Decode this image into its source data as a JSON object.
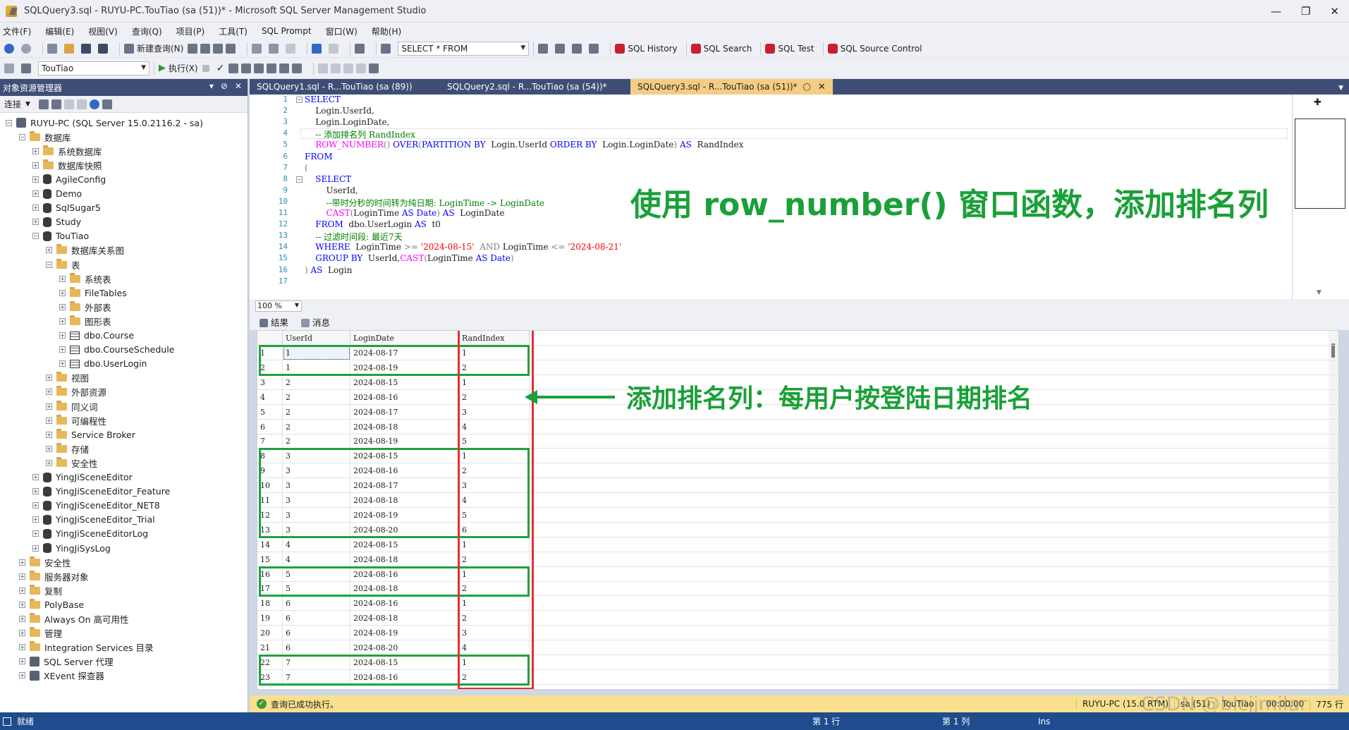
{
  "window": {
    "title": "SQLQuery3.sql - RUYU-PC.TouTiao (sa (51))* - Microsoft SQL Server Management Studio"
  },
  "menu": [
    "文件(F)",
    "编辑(E)",
    "视图(V)",
    "查询(Q)",
    "项目(P)",
    "工具(T)",
    "SQL Prompt",
    "窗口(W)",
    "帮助(H)"
  ],
  "toolbar1": {
    "new_query": "新建查询(N)",
    "combo_value": "SELECT * FROM",
    "sql_history": "SQL History",
    "sql_search": "SQL Search",
    "sql_test": "SQL Test",
    "sql_source_control": "SQL Source Control"
  },
  "toolbar2": {
    "database": "TouTiao",
    "execute": "执行(X)"
  },
  "object_explorer": {
    "title": "对象资源管理器",
    "connect": "连接",
    "items": [
      {
        "label": "RUYU-PC (SQL Server 15.0.2116.2 - sa)",
        "depth": 0,
        "icon": "server-icon",
        "expanded": true
      },
      {
        "label": "数据库",
        "depth": 1,
        "icon": "folder-icon",
        "expanded": true
      },
      {
        "label": "系统数据库",
        "depth": 2,
        "icon": "folder-icon",
        "expanded": false
      },
      {
        "label": "数据库快照",
        "depth": 2,
        "icon": "folder-icon",
        "expanded": false
      },
      {
        "label": "AgileConfig",
        "depth": 2,
        "icon": "database-icon",
        "expanded": false
      },
      {
        "label": "Demo",
        "depth": 2,
        "icon": "database-icon",
        "expanded": false
      },
      {
        "label": "SqlSugar5",
        "depth": 2,
        "icon": "database-icon",
        "expanded": false
      },
      {
        "label": "Study",
        "depth": 2,
        "icon": "database-icon",
        "expanded": false
      },
      {
        "label": "TouTiao",
        "depth": 2,
        "icon": "database-icon",
        "expanded": true
      },
      {
        "label": "数据库关系图",
        "depth": 3,
        "icon": "folder-icon",
        "expanded": false
      },
      {
        "label": "表",
        "depth": 3,
        "icon": "folder-icon",
        "expanded": true
      },
      {
        "label": "系统表",
        "depth": 4,
        "icon": "folder-icon",
        "expanded": false
      },
      {
        "label": "FileTables",
        "depth": 4,
        "icon": "folder-icon",
        "expanded": false
      },
      {
        "label": "外部表",
        "depth": 4,
        "icon": "folder-icon",
        "expanded": false
      },
      {
        "label": "图形表",
        "depth": 4,
        "icon": "folder-icon",
        "expanded": false
      },
      {
        "label": "dbo.Course",
        "depth": 4,
        "icon": "table-icon",
        "expanded": false
      },
      {
        "label": "dbo.CourseSchedule",
        "depth": 4,
        "icon": "table-icon",
        "expanded": false
      },
      {
        "label": "dbo.UserLogin",
        "depth": 4,
        "icon": "table-icon",
        "expanded": false
      },
      {
        "label": "视图",
        "depth": 3,
        "icon": "folder-icon",
        "expanded": false
      },
      {
        "label": "外部资源",
        "depth": 3,
        "icon": "folder-icon",
        "expanded": false
      },
      {
        "label": "同义词",
        "depth": 3,
        "icon": "folder-icon",
        "expanded": false
      },
      {
        "label": "可编程性",
        "depth": 3,
        "icon": "folder-icon",
        "expanded": false
      },
      {
        "label": "Service Broker",
        "depth": 3,
        "icon": "folder-icon",
        "expanded": false
      },
      {
        "label": "存储",
        "depth": 3,
        "icon": "folder-icon",
        "expanded": false
      },
      {
        "label": "安全性",
        "depth": 3,
        "icon": "folder-icon",
        "expanded": false
      },
      {
        "label": "YingJiSceneEditor",
        "depth": 2,
        "icon": "database-icon",
        "expanded": false
      },
      {
        "label": "YingJiSceneEditor_Feature",
        "depth": 2,
        "icon": "database-icon",
        "expanded": false
      },
      {
        "label": "YingJiSceneEditor_NET8",
        "depth": 2,
        "icon": "database-icon",
        "expanded": false
      },
      {
        "label": "YingJiSceneEditor_Trial",
        "depth": 2,
        "icon": "database-icon",
        "expanded": false
      },
      {
        "label": "YingJiSceneEditorLog",
        "depth": 2,
        "icon": "database-icon",
        "expanded": false
      },
      {
        "label": "YingJiSysLog",
        "depth": 2,
        "icon": "database-icon",
        "expanded": false
      },
      {
        "label": "安全性",
        "depth": 1,
        "icon": "folder-icon",
        "expanded": false
      },
      {
        "label": "服务器对象",
        "depth": 1,
        "icon": "folder-icon",
        "expanded": false
      },
      {
        "label": "复制",
        "depth": 1,
        "icon": "folder-icon",
        "expanded": false
      },
      {
        "label": "PolyBase",
        "depth": 1,
        "icon": "folder-icon",
        "expanded": false
      },
      {
        "label": "Always On 高可用性",
        "depth": 1,
        "icon": "folder-icon",
        "expanded": false
      },
      {
        "label": "管理",
        "depth": 1,
        "icon": "folder-icon",
        "expanded": false
      },
      {
        "label": "Integration Services 目录",
        "depth": 1,
        "icon": "folder-icon",
        "expanded": false
      },
      {
        "label": "SQL Server 代理",
        "depth": 1,
        "icon": "agent-icon",
        "expanded": false
      },
      {
        "label": "XEvent 探查器",
        "depth": 1,
        "icon": "xevent-icon",
        "expanded": false
      }
    ]
  },
  "tabs": [
    {
      "label": "SQLQuery1.sql - R...TouTiao (sa (89))",
      "active": false
    },
    {
      "label": "SQLQuery2.sql - R...TouTiao (sa (54))*",
      "active": false
    },
    {
      "label": "SQLQuery3.sql - R...TouTiao (sa (51))*",
      "active": true
    }
  ],
  "editor": {
    "lines": [
      [
        [
          "kw",
          "SELECT"
        ]
      ],
      [
        [
          "",
          "    Login.UserId,"
        ]
      ],
      [
        [
          "",
          "    Login.LoginDate,"
        ]
      ],
      [
        [
          "cm",
          "    -- 添加排名列 RandIndex"
        ]
      ],
      [
        [
          "fn",
          "    ROW_NUMBER"
        ],
        [
          "op",
          "() "
        ],
        [
          "kw",
          "OVER"
        ],
        [
          "op",
          "("
        ],
        [
          "kw",
          "PARTITION BY"
        ],
        [
          "",
          "  Login.UserId "
        ],
        [
          "kw",
          "ORDER BY"
        ],
        [
          "",
          "  Login.LoginDate"
        ],
        [
          "op",
          ")"
        ],
        [
          "kw",
          " AS"
        ],
        [
          "",
          "  RandIndex"
        ]
      ],
      [
        [
          "kw",
          "FROM"
        ]
      ],
      [
        [
          "op",
          "("
        ]
      ],
      [
        [
          "kw",
          "    SELECT"
        ]
      ],
      [
        [
          "",
          "        UserId,"
        ]
      ],
      [
        [
          "cm",
          "        --带时分秒的时间转为纯日期: LoginTime -> LoginDate"
        ]
      ],
      [
        [
          "fn",
          "        CAST"
        ],
        [
          "op",
          "("
        ],
        [
          "",
          "LoginTime "
        ],
        [
          "kw",
          "AS Date"
        ],
        [
          "op",
          ") "
        ],
        [
          "kw",
          "AS"
        ],
        [
          "",
          "  LoginDate"
        ]
      ],
      [
        [
          "kw",
          "    FROM"
        ],
        [
          "",
          "  dbo.UserLogin "
        ],
        [
          "kw",
          "AS"
        ],
        [
          "",
          "  t0"
        ]
      ],
      [
        [
          "cm",
          "    -- 过滤时间段: 最近7天"
        ]
      ],
      [
        [
          "kw",
          "    WHERE"
        ],
        [
          "",
          "  LoginTime "
        ],
        [
          "op",
          ">= "
        ],
        [
          "str",
          "'2024-08-15'"
        ],
        [
          "op",
          "  AND "
        ],
        [
          "",
          "LoginTime "
        ],
        [
          "op",
          "<= "
        ],
        [
          "str",
          "'2024-08-21'"
        ]
      ],
      [
        [
          "kw",
          "    GROUP BY"
        ],
        [
          "",
          "  UserId,"
        ],
        [
          "fn",
          "CAST"
        ],
        [
          "op",
          "("
        ],
        [
          "",
          "LoginTime "
        ],
        [
          "kw",
          "AS Date"
        ],
        [
          "op",
          ")"
        ]
      ],
      [
        [
          "op",
          ") "
        ],
        [
          "kw",
          "AS"
        ],
        [
          "",
          "  Login"
        ]
      ],
      [
        [
          "",
          ""
        ]
      ]
    ]
  },
  "zoom": "100 %",
  "results": {
    "tab_results": "结果",
    "tab_messages": "消息",
    "columns": [
      "UserId",
      "LoginDate",
      "RandIndex"
    ],
    "rows": [
      [
        "1",
        "1",
        "2024-08-17",
        "1"
      ],
      [
        "2",
        "1",
        "2024-08-19",
        "2"
      ],
      [
        "3",
        "2",
        "2024-08-15",
        "1"
      ],
      [
        "4",
        "2",
        "2024-08-16",
        "2"
      ],
      [
        "5",
        "2",
        "2024-08-17",
        "3"
      ],
      [
        "6",
        "2",
        "2024-08-18",
        "4"
      ],
      [
        "7",
        "2",
        "2024-08-19",
        "5"
      ],
      [
        "8",
        "3",
        "2024-08-15",
        "1"
      ],
      [
        "9",
        "3",
        "2024-08-16",
        "2"
      ],
      [
        "10",
        "3",
        "2024-08-17",
        "3"
      ],
      [
        "11",
        "3",
        "2024-08-18",
        "4"
      ],
      [
        "12",
        "3",
        "2024-08-19",
        "5"
      ],
      [
        "13",
        "3",
        "2024-08-20",
        "6"
      ],
      [
        "14",
        "4",
        "2024-08-15",
        "1"
      ],
      [
        "15",
        "4",
        "2024-08-18",
        "2"
      ],
      [
        "16",
        "5",
        "2024-08-16",
        "1"
      ],
      [
        "17",
        "5",
        "2024-08-18",
        "2"
      ],
      [
        "18",
        "6",
        "2024-08-16",
        "1"
      ],
      [
        "19",
        "6",
        "2024-08-18",
        "2"
      ],
      [
        "20",
        "6",
        "2024-08-19",
        "3"
      ],
      [
        "21",
        "6",
        "2024-08-20",
        "4"
      ],
      [
        "22",
        "7",
        "2024-08-15",
        "1"
      ],
      [
        "23",
        "7",
        "2024-08-16",
        "2"
      ]
    ],
    "highlight_groups": [
      [
        1,
        2
      ],
      [
        8,
        13
      ],
      [
        16,
        17
      ],
      [
        22,
        23
      ]
    ]
  },
  "annotations": {
    "title": "使用 row_number() 窗口函数，添加排名列",
    "note": "添加排名列：每用户按登陆日期排名"
  },
  "query_status": {
    "message": "查询已成功执行。",
    "server": "RUYU-PC (15.0 RTM)",
    "user": "sa (51)",
    "database": "TouTiao",
    "time": "00:00:00",
    "rows": "775 行"
  },
  "statusbar": {
    "ready": "就绪",
    "line": "第 1 行",
    "col": "第 1 列",
    "ins": "Ins"
  },
  "watermark": "CSDN @blcjjmilar",
  "colors": {
    "accent": "#3f4e76",
    "tab_active": "#f5cc84",
    "highlight_green": "#1fa23e",
    "highlight_red": "#e03035",
    "status_blue": "#1e4c8c"
  }
}
